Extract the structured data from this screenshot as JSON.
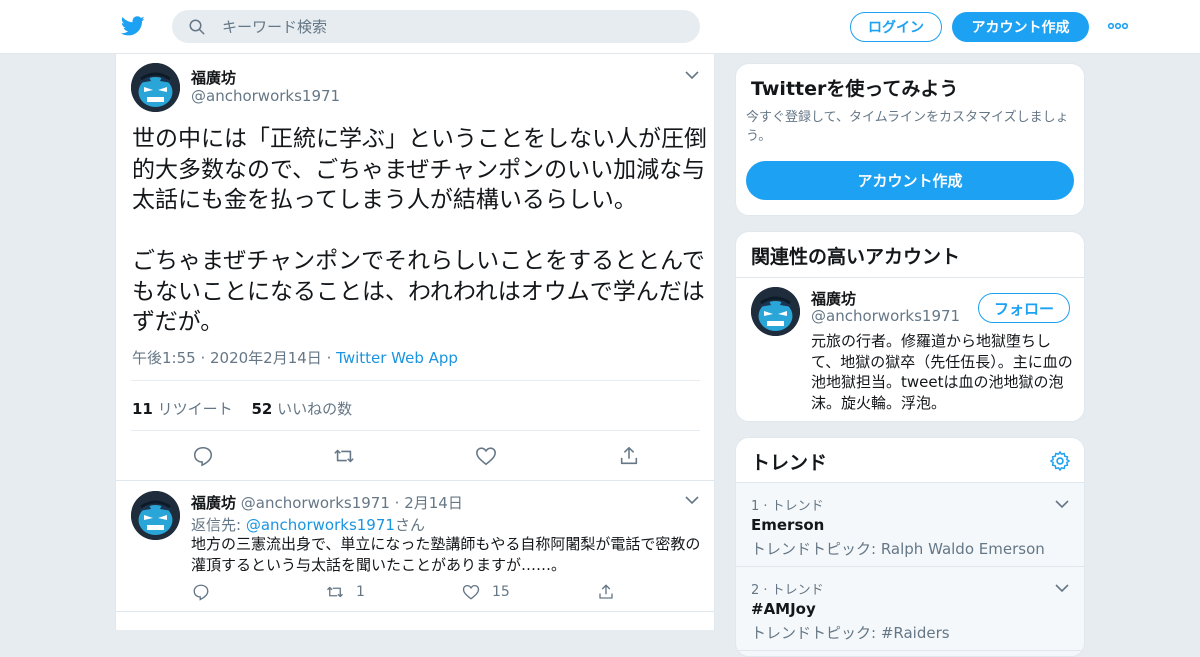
{
  "colors": {
    "accent": "#1da1f2",
    "link": "#1b95e0",
    "muted": "#657786",
    "background": "#e6ecf0"
  },
  "topbar": {
    "search_placeholder": "キーワード検索",
    "login_label": "ログイン",
    "signup_label": "アカウント作成"
  },
  "tweet": {
    "author_name": "福廣坊",
    "author_handle": "@anchorworks1971",
    "text": "世の中には「正統に学ぶ」ということをしない人が圧倒的大多数なので、ごちゃまぜチャンポンのいい加減な与太話にも金を払ってしまう人が結構いるらしい。\n\nごちゃまぜチャンポンでそれらしいことをするととんでもないことになることは、われわれはオウムで学んだはずだが。",
    "time": "午後1:55 · 2020年2月14日",
    "separator": "·",
    "app": "Twitter Web App",
    "retweet_count": "11",
    "retweet_label": "リツイート",
    "like_count": "52",
    "like_label": "いいねの数"
  },
  "reply": {
    "author_name": "福廣坊",
    "author_handle": "@anchorworks1971",
    "date": "· 2月14日",
    "reply_to_prefix": "返信先:",
    "reply_to_handle": "@anchorworks1971",
    "reply_to_suffix": "さん",
    "text": "地方の三憲流出身で、単立になった塾講師もやる自称阿闍梨が電話で密教の灌頂するという与太話を聞いたことがありますが……。",
    "retweets": "1",
    "likes": "15"
  },
  "signup_card": {
    "title": "Twitterを使ってみよう",
    "description": "今すぐ登録して、タイムラインをカスタマイズしましょう。",
    "button_label": "アカウント作成"
  },
  "related": {
    "title": "関連性の高いアカウント",
    "name": "福廣坊",
    "handle": "@anchorworks1971",
    "follow_label": "フォロー",
    "bio": "元旅の行者。修羅道から地獄堕ちして、地獄の獄卒（先任伍長）。主に血の池地獄担当。tweetは血の池地獄の泡沫。旋火輪。浮泡。"
  },
  "trends": {
    "title": "トレンド",
    "items": [
      {
        "rank": "1 · トレンド",
        "name": "Emerson",
        "desc": "トレンドトピック: Ralph Waldo Emerson"
      },
      {
        "rank": "2 · トレンド",
        "name": "#AMJoy",
        "desc": "トレンドトピック: #Raiders"
      }
    ]
  }
}
